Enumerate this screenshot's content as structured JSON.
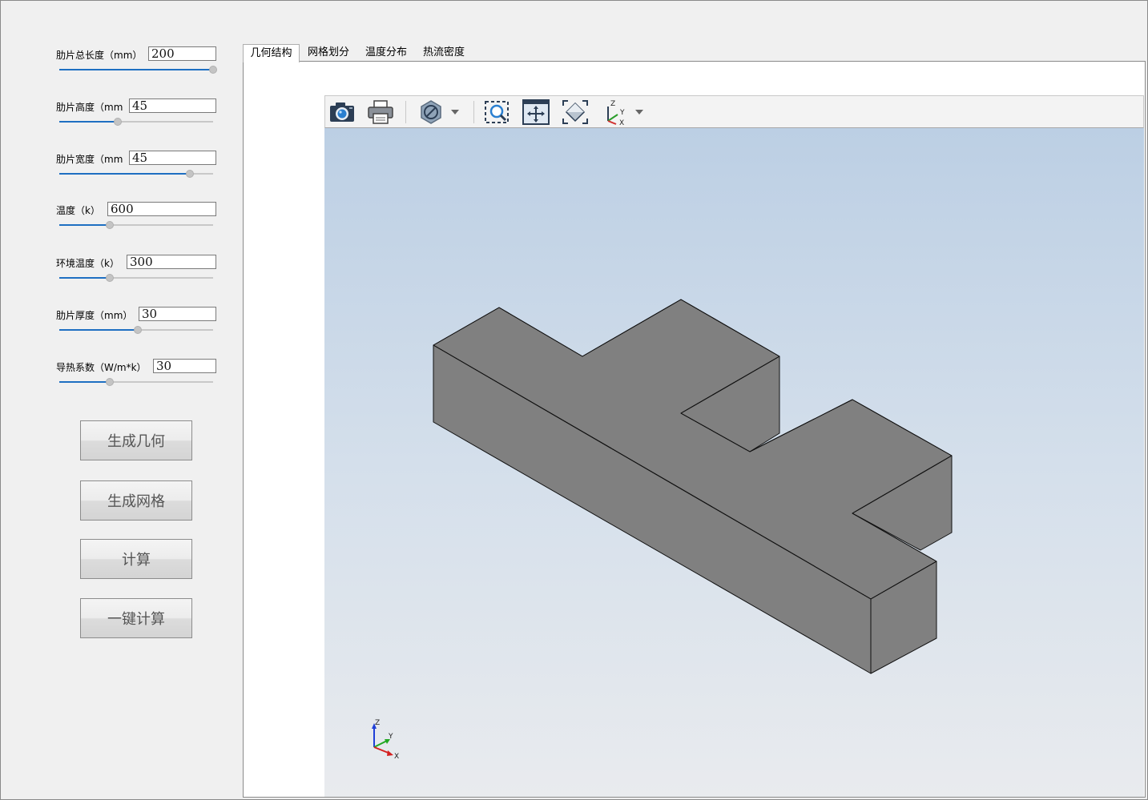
{
  "params": [
    {
      "label": "肋片总长度（mm）",
      "value": "200",
      "slider": 1.0
    },
    {
      "label": "肋片高度（mm",
      "value": "45",
      "slider": 0.38
    },
    {
      "label": "肋片宽度（mm",
      "value": "45",
      "slider": 0.85
    },
    {
      "label": "温度（k）",
      "value": "600",
      "slider": 0.33
    },
    {
      "label": "环境温度（k）",
      "value": "300",
      "slider": 0.33
    },
    {
      "label": "肋片厚度（mm）",
      "value": "30",
      "slider": 0.51
    },
    {
      "label": "导热系数（W/m*k）",
      "value": "30",
      "slider": 0.33
    }
  ],
  "buttons": {
    "generate_geometry": "生成几何",
    "generate_mesh": "生成网格",
    "compute": "计算",
    "one_click": "一键计算"
  },
  "tabs": [
    "几何结构",
    "网格划分",
    "温度分布",
    "热流密度"
  ],
  "active_tab": "几何结构",
  "toolbar": {
    "icons": [
      "camera-icon",
      "print-icon",
      "no-symbol-icon",
      "zoom-box-icon",
      "pan-icon",
      "fit-view-icon",
      "axes-icon"
    ]
  },
  "viewport": {
    "axis_labels": {
      "x": "X",
      "y": "Y",
      "z": "Z"
    },
    "toolbar_axis_labels": {
      "x": "X",
      "y": "Y",
      "z": "Z"
    },
    "solid_color": "#808080",
    "accent": "#1e6fc2"
  }
}
